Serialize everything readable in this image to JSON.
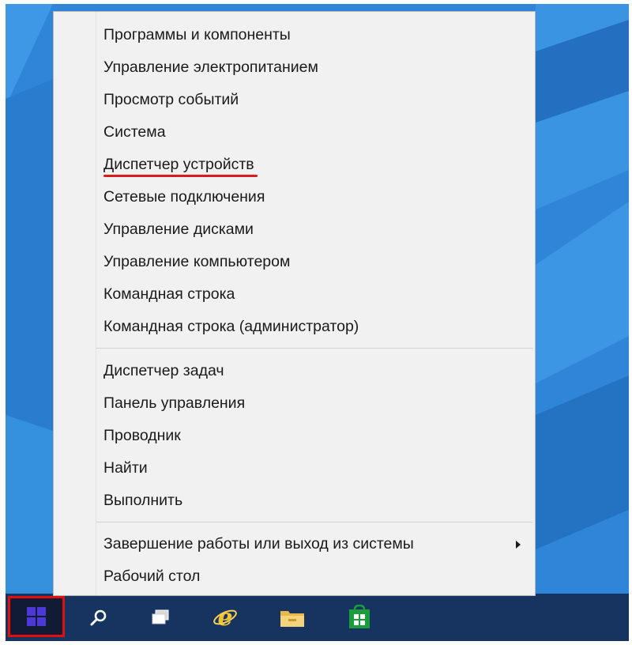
{
  "menu": {
    "group1": [
      {
        "label": "Программы и компоненты"
      },
      {
        "label": "Управление электропитанием"
      },
      {
        "label": "Просмотр событий"
      },
      {
        "label": "Система"
      },
      {
        "label": "Диспетчер устройств"
      },
      {
        "label": "Сетевые подключения"
      },
      {
        "label": "Управление дисками"
      },
      {
        "label": "Управление компьютером"
      },
      {
        "label": "Командная строка"
      },
      {
        "label": "Командная строка (администратор)"
      }
    ],
    "group2": [
      {
        "label": "Диспетчер задач"
      },
      {
        "label": "Панель управления"
      },
      {
        "label": "Проводник"
      },
      {
        "label": "Найти"
      },
      {
        "label": "Выполнить"
      }
    ],
    "group3": [
      {
        "label": "Завершение работы или выход из системы"
      },
      {
        "label": "Рабочий стол"
      }
    ],
    "highlighted_item": "Диспетчер устройств",
    "highlight_color": "#d81b1b"
  },
  "taskbar": {
    "icons": [
      "windows-logo-icon",
      "search-icon",
      "task-view-icon",
      "internet-explorer-icon",
      "file-explorer-icon",
      "store-icon"
    ],
    "start_highlight_color": "#e01010"
  },
  "colors": {
    "desktop_blue": "#2f86d9",
    "taskbar": "#16345f",
    "menu_bg": "#f1f1f1"
  }
}
